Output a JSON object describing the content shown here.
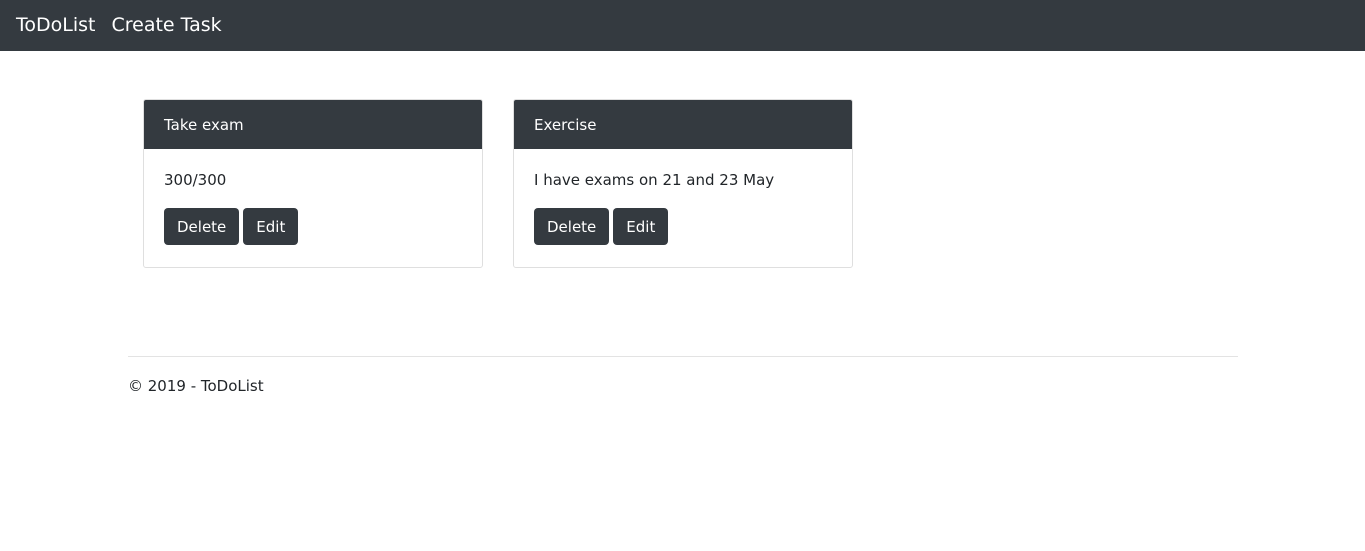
{
  "navbar": {
    "brand": "ToDoList",
    "links": [
      "Create Task"
    ]
  },
  "tasks": [
    {
      "title": "Take exam",
      "description": "300/300",
      "delete_label": "Delete",
      "edit_label": "Edit"
    },
    {
      "title": "Exercise",
      "description": "I have exams on 21 and 23 May",
      "delete_label": "Delete",
      "edit_label": "Edit"
    }
  ],
  "footer": {
    "text": "© 2019 - ToDoList"
  },
  "colors": {
    "dark": "#343a40",
    "background": "#ffffff"
  }
}
